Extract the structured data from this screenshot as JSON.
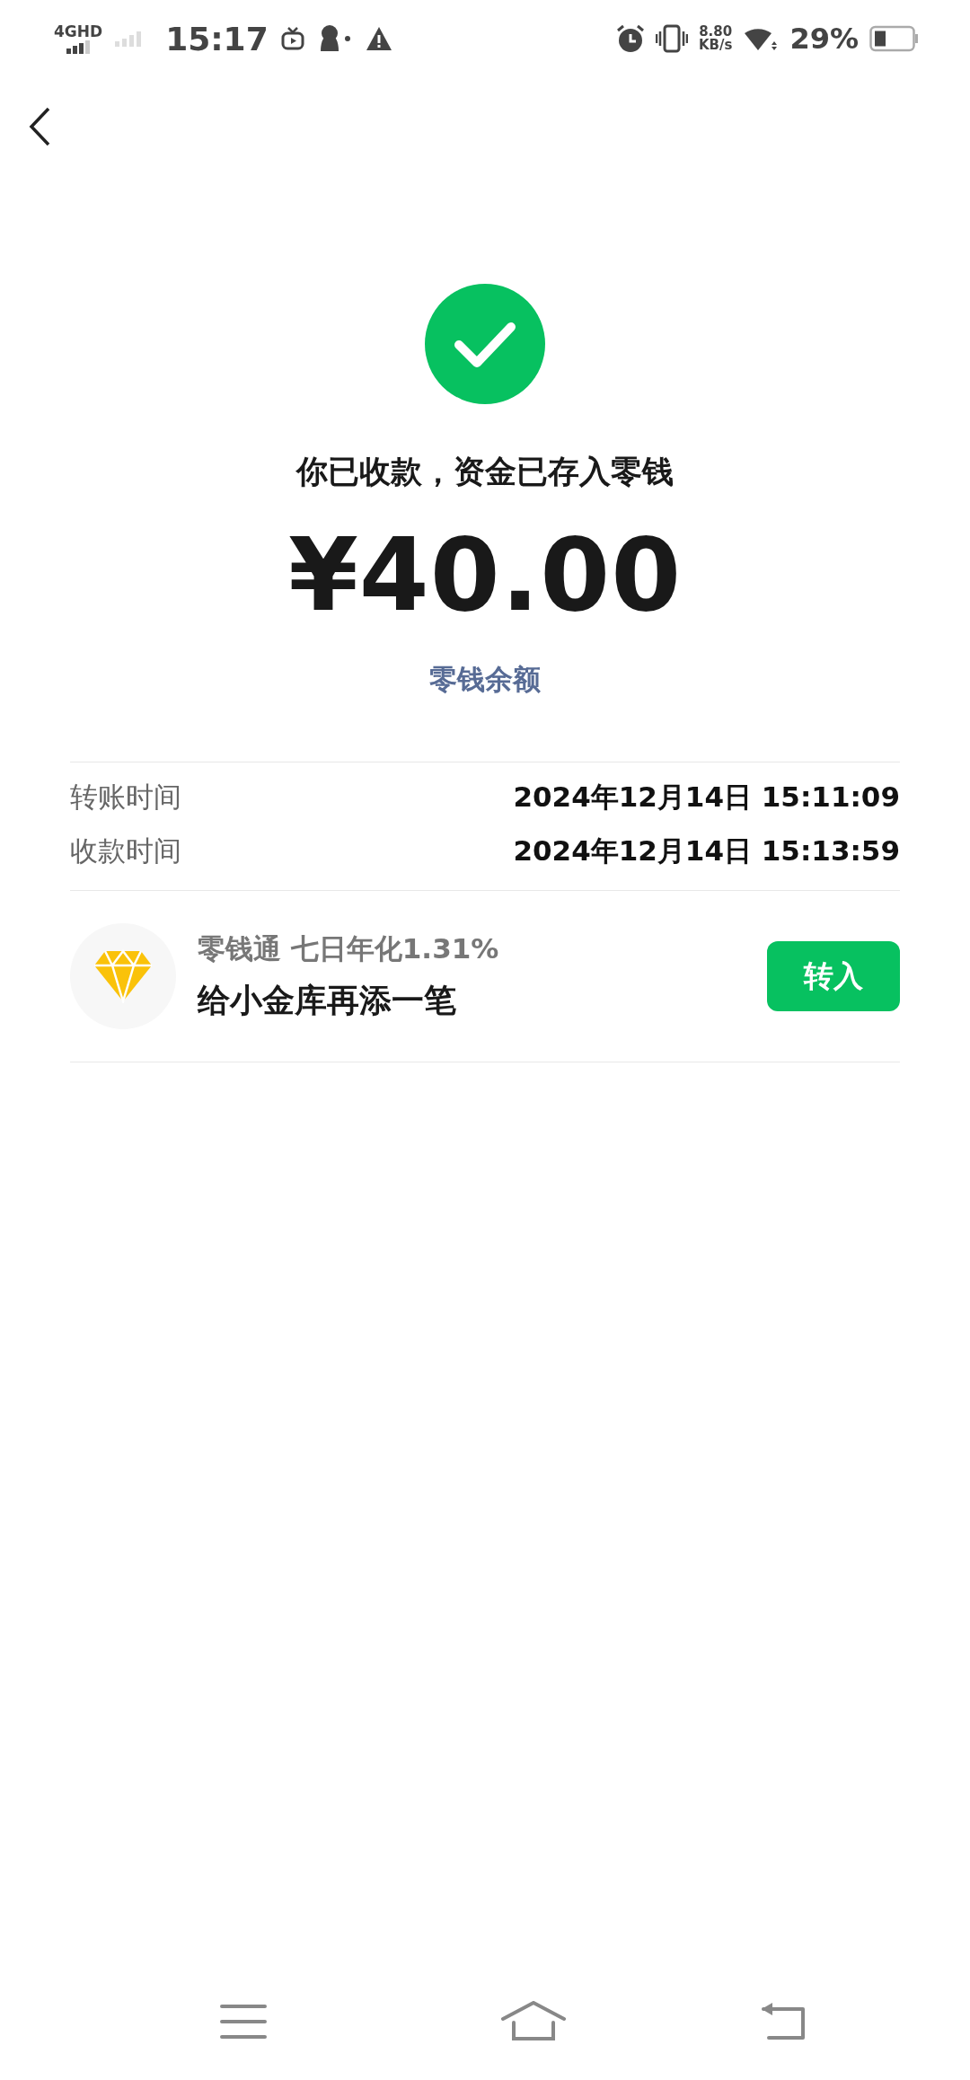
{
  "status_bar": {
    "network": "4GHD",
    "time": "15:17",
    "speed": "8.80",
    "speed_unit": "KB/s",
    "battery": "29%"
  },
  "result": {
    "message": "你已收款，资金已存入零钱",
    "amount": "¥40.00",
    "link": "零钱余额"
  },
  "details": [
    {
      "label": "转账时间",
      "value": "2024年12月14日 15:11:09"
    },
    {
      "label": "收款时间",
      "value": "2024年12月14日 15:13:59"
    }
  ],
  "promo": {
    "subtitle": "零钱通 七日年化1.31%",
    "title": "给小金库再添一笔",
    "button": "转入"
  }
}
